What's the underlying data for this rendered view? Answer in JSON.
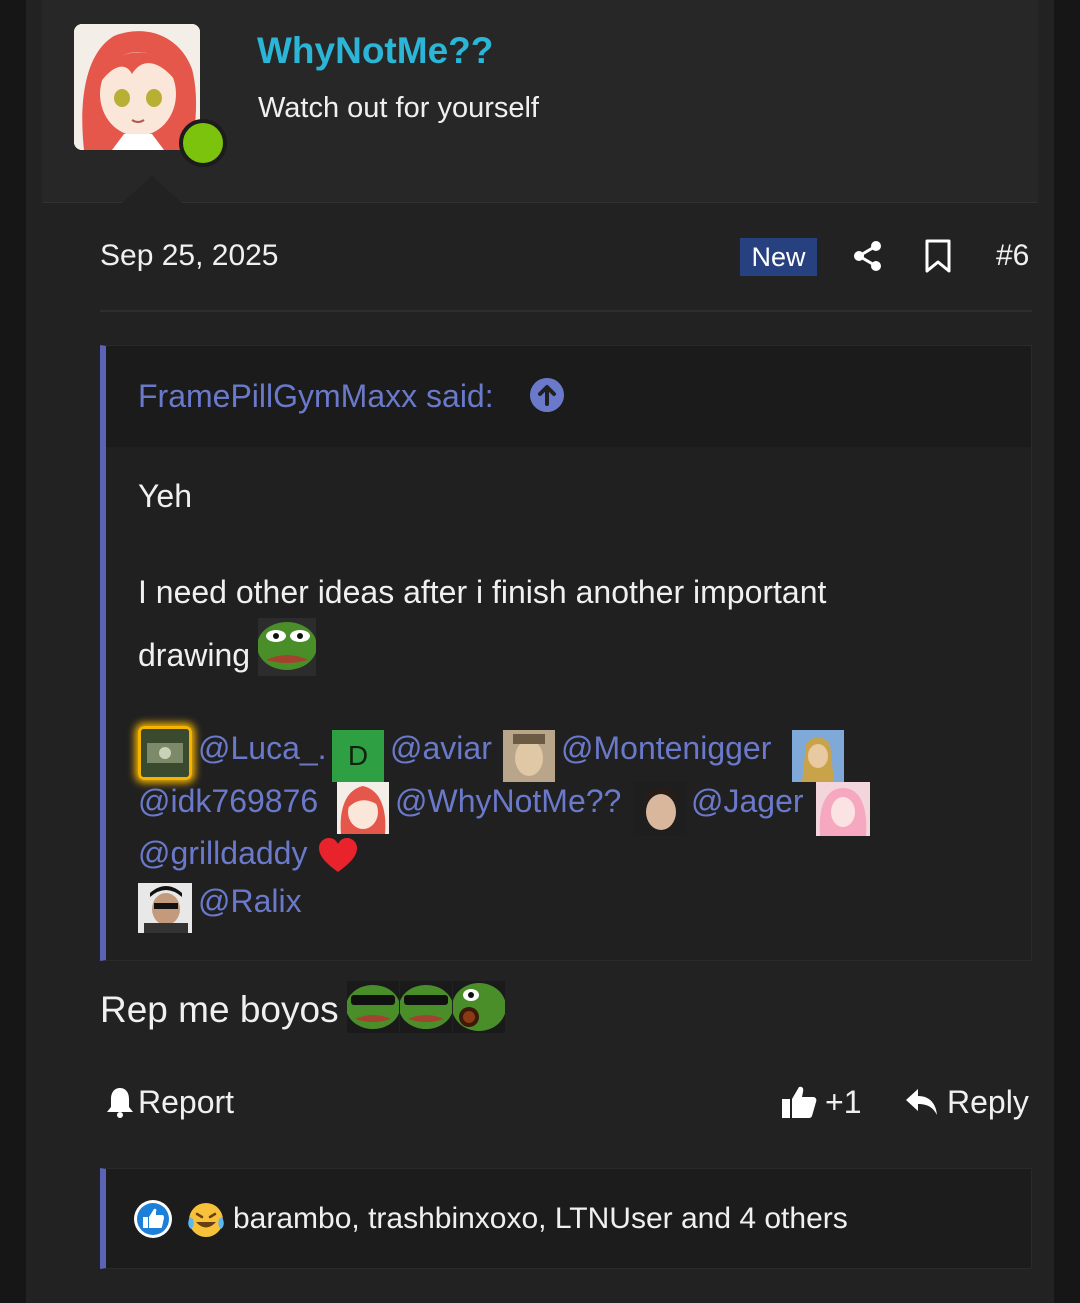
{
  "post": {
    "username": "WhyNotMe??",
    "user_title": "Watch out for yourself",
    "date": "Sep 25, 2025",
    "new_badge": "New",
    "post_number": "#6",
    "quote": {
      "author": "FramePillGymMaxx said:",
      "line1": "Yeh",
      "line2": "I need other ideas after i finish another important",
      "line3": "drawing",
      "mentions": [
        "@Luca_.",
        "@aviar",
        "@Montenigger",
        "@idk769876",
        "@WhyNotMe??",
        "@Jager",
        "@grilldaddy",
        "@Ralix"
      ],
      "mention_badge_letter": "D"
    },
    "body": "Rep me boyos",
    "actions": {
      "report": "Report",
      "react": "+1",
      "reply": "Reply"
    },
    "reactions_summary": "barambo, trashbinxoxo, LTNUser and 4 others"
  },
  "colors": {
    "username": "#2bb5d6",
    "link": "#6a79c9",
    "online": "#7cc30e",
    "new_badge": "#27407f",
    "quote_border": "#5a63b6"
  },
  "icons": [
    "share-icon",
    "bookmark-icon",
    "arrow-up-circle-icon",
    "bell-icon",
    "thumbs-up-icon",
    "reply-icon",
    "like-reaction-icon",
    "laugh-cry-reaction-icon",
    "heart-icon"
  ]
}
